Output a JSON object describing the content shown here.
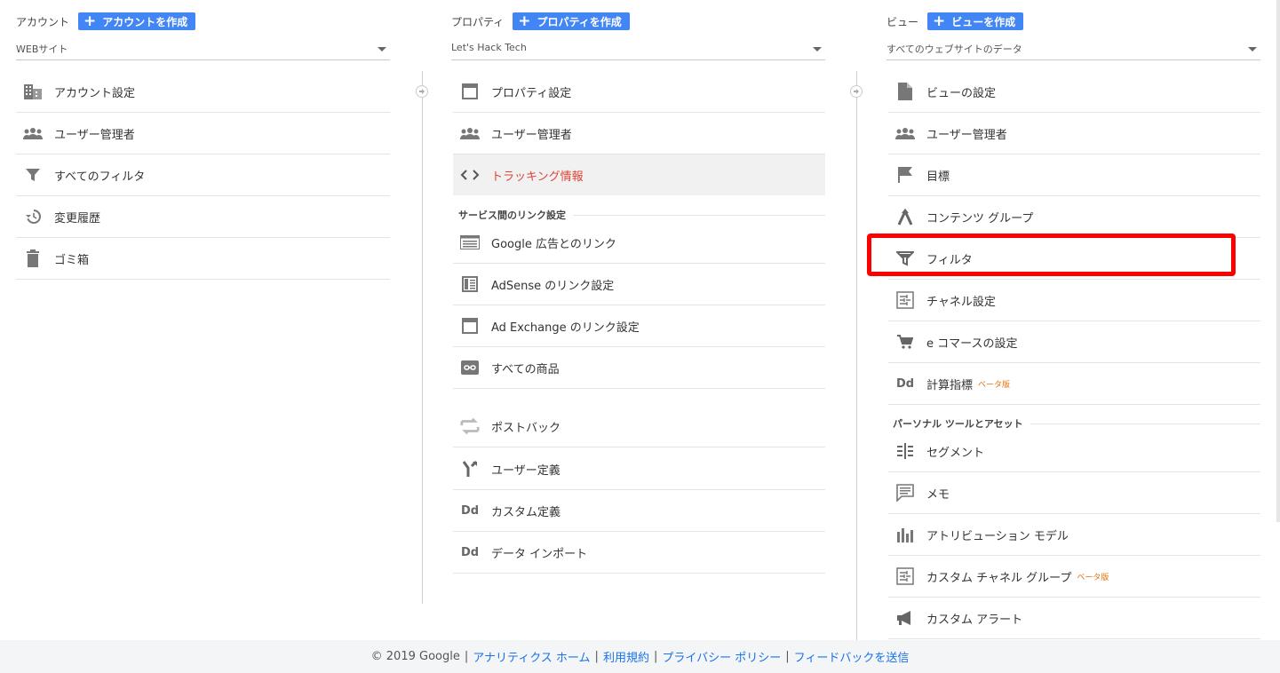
{
  "account": {
    "label": "アカウント",
    "create_button": "アカウントを作成",
    "selected": "WEBサイト",
    "items": [
      {
        "label": "アカウント設定",
        "icon": "building-icon"
      },
      {
        "label": "ユーザー管理者",
        "icon": "people-icon"
      },
      {
        "label": "すべてのフィルタ",
        "icon": "filter-icon"
      },
      {
        "label": "変更履歴",
        "icon": "history-icon"
      },
      {
        "label": "ゴミ箱",
        "icon": "trash-icon"
      }
    ]
  },
  "property": {
    "label": "プロパティ",
    "create_button": "プロパティを作成",
    "selected": "Let's Hack Tech",
    "items": [
      {
        "label": "プロパティ設定",
        "icon": "square-icon"
      },
      {
        "label": "ユーザー管理者",
        "icon": "people-icon"
      },
      {
        "label": "トラッキング情報",
        "icon": "code-icon",
        "active": true
      }
    ],
    "section_title": "サービス間のリンク設定",
    "link_items": [
      {
        "label": "Google 広告とのリンク",
        "icon": "ads-icon"
      },
      {
        "label": "AdSense のリンク設定",
        "icon": "adsense-icon"
      },
      {
        "label": "Ad Exchange のリンク設定",
        "icon": "square-icon"
      },
      {
        "label": "すべての商品",
        "icon": "link-icon"
      }
    ],
    "more_items": [
      {
        "label": "ポストバック",
        "icon": "postback-icon"
      },
      {
        "label": "ユーザー定義",
        "icon": "fork-icon"
      },
      {
        "label": "カスタム定義",
        "icon": "dd-icon",
        "icon_text": "Dd"
      },
      {
        "label": "データ インポート",
        "icon": "dd-icon",
        "icon_text": "Dd"
      }
    ]
  },
  "view": {
    "label": "ビュー",
    "create_button": "ビューを作成",
    "selected": "すべてのウェブサイトのデータ",
    "items": [
      {
        "label": "ビューの設定",
        "icon": "document-icon"
      },
      {
        "label": "ユーザー管理者",
        "icon": "people-icon"
      },
      {
        "label": "目標",
        "icon": "flag-icon"
      },
      {
        "label": "コンテンツ グループ",
        "icon": "content-group-icon"
      },
      {
        "label": "フィルタ",
        "icon": "filter-outline-icon"
      },
      {
        "label": "チャネル設定",
        "icon": "channel-icon"
      },
      {
        "label": "e コマースの設定",
        "icon": "cart-icon"
      },
      {
        "label": "計算指標",
        "icon": "dd-icon",
        "icon_text": "Dd",
        "beta": "ベータ版"
      }
    ],
    "section_title": "パーソナル ツールとアセット",
    "personal_items": [
      {
        "label": "セグメント",
        "icon": "segment-icon"
      },
      {
        "label": "メモ",
        "icon": "memo-icon"
      },
      {
        "label": "アトリビューション モデル",
        "icon": "attribution-icon"
      },
      {
        "label": "カスタム チャネル グループ",
        "icon": "channel-icon",
        "beta": "ベータ版"
      },
      {
        "label": "カスタム アラート",
        "icon": "megaphone-icon"
      }
    ]
  },
  "footer": {
    "copyright": "© 2019 Google",
    "links": [
      "アナリティクス ホーム",
      "利用規約",
      "プライバシー ポリシー",
      "フィードバックを送信"
    ],
    "separator": "|"
  }
}
